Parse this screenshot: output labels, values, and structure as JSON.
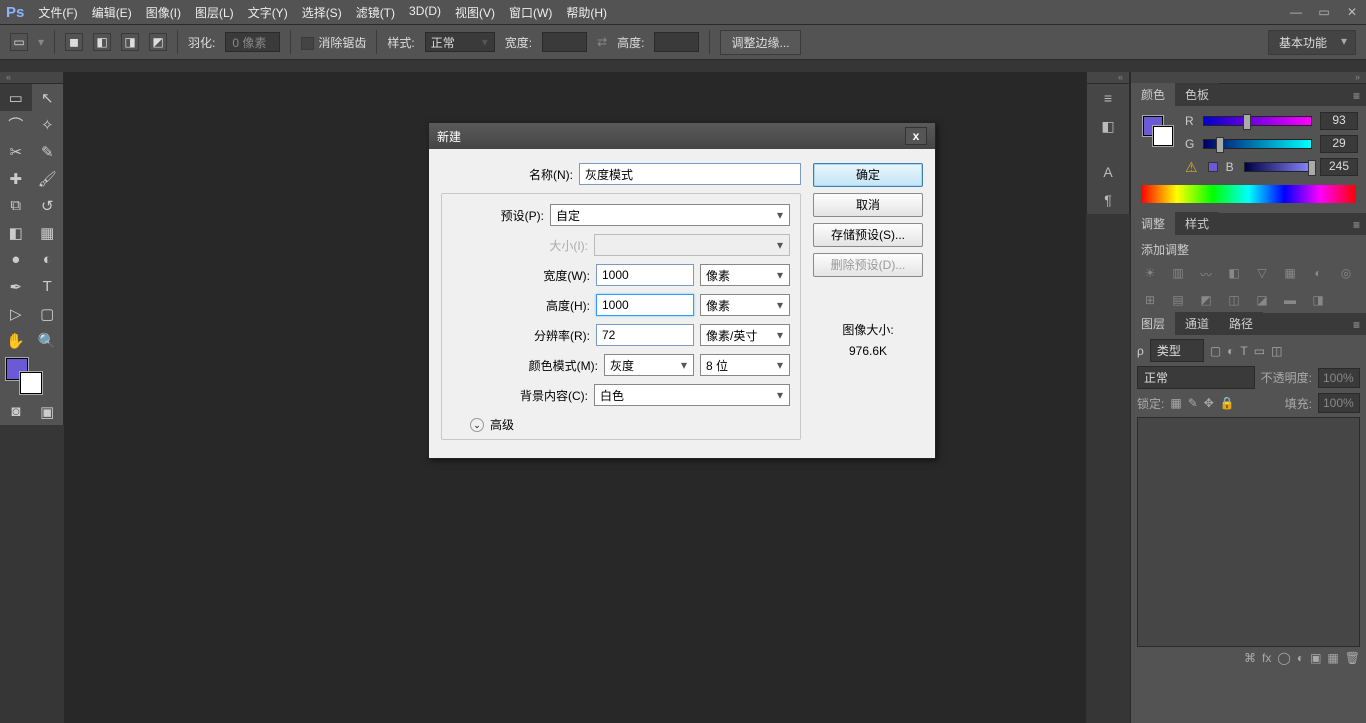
{
  "app": {
    "logo": "Ps"
  },
  "menu": [
    "文件(F)",
    "编辑(E)",
    "图像(I)",
    "图层(L)",
    "文字(Y)",
    "选择(S)",
    "滤镜(T)",
    "3D(D)",
    "视图(V)",
    "窗口(W)",
    "帮助(H)"
  ],
  "optbar": {
    "feather_label": "羽化:",
    "feather_value": "0 像素",
    "antialias": "消除锯齿",
    "style_label": "样式:",
    "style_value": "正常",
    "width_label": "宽度:",
    "height_label": "高度:",
    "refine": "调整边缘...",
    "workspace": "基本功能"
  },
  "color_panel": {
    "tab_color": "颜色",
    "tab_swatch": "色板",
    "r": {
      "lab": "R",
      "val": "93",
      "pos": 36
    },
    "g": {
      "lab": "G",
      "val": "29",
      "pos": 11
    },
    "b": {
      "lab": "B",
      "val": "245",
      "pos": 96
    }
  },
  "adjust_panel": {
    "tab_adjust": "调整",
    "tab_style": "样式",
    "heading": "添加调整"
  },
  "layers_panel": {
    "tab_layers": "图层",
    "tab_channels": "通道",
    "tab_paths": "路径",
    "kind": "类型",
    "blend": "正常",
    "opacity_lab": "不透明度:",
    "opacity": "100%",
    "lock_lab": "锁定:",
    "fill_lab": "填充:",
    "fill": "100%"
  },
  "dialog": {
    "title": "新建",
    "name_label": "名称(N):",
    "name_value": "灰度模式",
    "preset_label": "预设(P):",
    "preset_value": "自定",
    "size_label": "大小(I):",
    "width_label": "宽度(W):",
    "width_value": "1000",
    "width_unit": "像素",
    "height_label": "高度(H):",
    "height_value": "1000",
    "height_unit": "像素",
    "res_label": "分辨率(R):",
    "res_value": "72",
    "res_unit": "像素/英寸",
    "mode_label": "颜色模式(M):",
    "mode_value": "灰度",
    "depth_value": "8 位",
    "bg_label": "背景内容(C):",
    "bg_value": "白色",
    "advanced": "高级",
    "ok": "确定",
    "cancel": "取消",
    "save_preset": "存储预设(S)...",
    "del_preset": "删除预设(D)...",
    "image_size_label": "图像大小:",
    "image_size_value": "976.6K"
  }
}
